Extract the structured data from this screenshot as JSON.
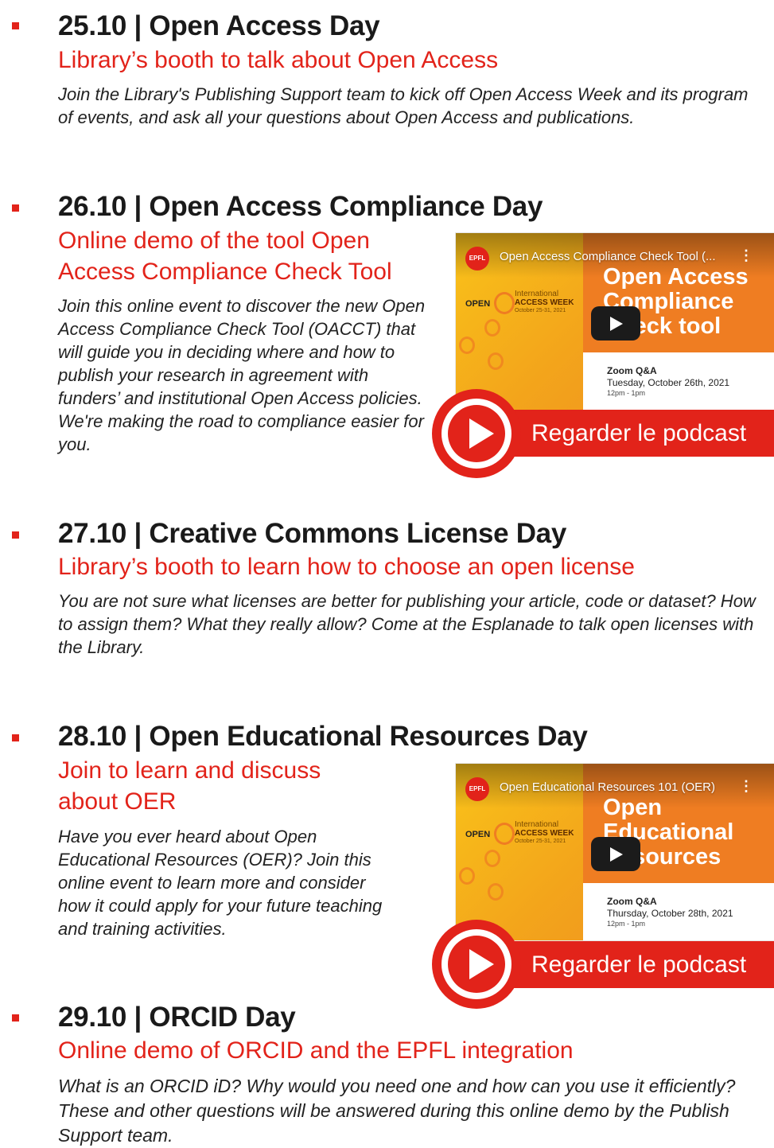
{
  "events": [
    {
      "heading": "25.10 | Open Access Day",
      "subtitle": "Library’s booth to talk about Open Access",
      "description": "Join the Library's Publishing Support team to kick off Open Access Week and its program of events, and ask all your questions about Open Access and publications."
    },
    {
      "heading": "26.10 | Open Access Compliance Day",
      "subtitle": "Online demo of the tool Open Access Compliance Check Tool",
      "description": "Join this online event to discover the new Open Access Compliance Check Tool (OACCT) that will guide you in deciding where and how to publish your research in agreement with funders’ and institutional Open Access policies. We're making the road to compliance easier for you.",
      "video": {
        "badge": "EPFL",
        "title": "Open Access Compliance Check Tool (...",
        "big_title": "Open Access Compliance Check tool",
        "oa_open": "OPEN",
        "oa_international": "International",
        "oa_access_week": "ACCESS WEEK",
        "oa_dates": "October 25-31, 2021",
        "zoom": "Zoom Q&A",
        "day": "Tuesday, October 26th, 2021",
        "time": "12pm - 1pm"
      },
      "podcast_label": "Regarder le podcast"
    },
    {
      "heading": "27.10 | Creative Commons License Day",
      "subtitle": "Library’s booth to learn how to choose an open license",
      "description": "You are not sure what licenses are better for publishing your article, code or dataset? How to assign them? What they really allow? Come at the Esplanade to talk open licenses with the Library."
    },
    {
      "heading": "28.10 | Open Educational Resources Day",
      "subtitle": "Join to learn and discuss about OER",
      "description": "Have you ever heard about Open Educational Resources (OER)? Join this online event to learn more and consider how it could apply for your future teaching and training activities.",
      "video": {
        "badge": "EPFL",
        "title": "Open Educational Resources 101 (OER)",
        "big_title": "Open Educational Resources",
        "oa_open": "OPEN",
        "oa_international": "International",
        "oa_access_week": "ACCESS WEEK",
        "oa_dates": "October 25-31, 2021",
        "zoom": "Zoom Q&A",
        "day": "Thursday, October 28th, 2021",
        "time": "12pm - 1pm"
      },
      "podcast_label": "Regarder le podcast"
    },
    {
      "heading": "29.10 | ORCID Day",
      "subtitle": "Online demo of ORCID and the EPFL integration",
      "description": "What is an ORCID iD? Why would you need one and how can you use it efficiently? These and other questions will be answered during this online demo by the Publish Support team."
    }
  ],
  "colors": {
    "accent": "#e2231a",
    "video_orange": "#ef7d22",
    "video_yellow": "#f9c21a"
  }
}
